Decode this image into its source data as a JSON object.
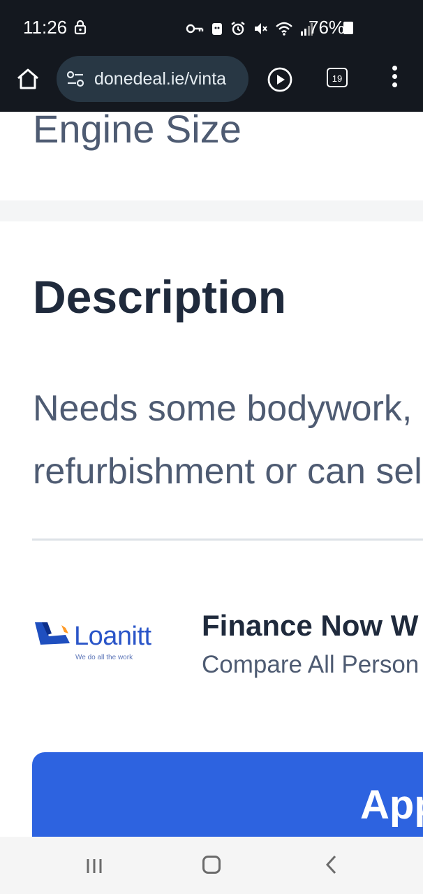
{
  "status_bar": {
    "time": "11:26",
    "battery": "76%",
    "icons": [
      "lock-icon",
      "vpn-key-icon",
      "android-icon",
      "alarm-icon",
      "mute-icon",
      "wifi-icon",
      "signal-icon",
      "battery-icon"
    ]
  },
  "browser": {
    "url": "donedeal.ie/vinta",
    "tab_count": "19"
  },
  "content": {
    "engine_size_label": "Engine Size",
    "description_heading": "Description",
    "description_lines": [
      "Needs some bodywork, i",
      "refurbishment or can sel"
    ],
    "finance": {
      "logo_name": "Loanitt",
      "logo_tagline": "We do all the work",
      "title": "Finance Now W",
      "subtitle": "Compare All Person",
      "button_label": "App"
    }
  },
  "colors": {
    "status_bg": "#14181f",
    "url_bg": "#283744",
    "apply_button": "#2d63e0",
    "heading": "#1f2a3c",
    "body_text": "#4e5b72"
  }
}
